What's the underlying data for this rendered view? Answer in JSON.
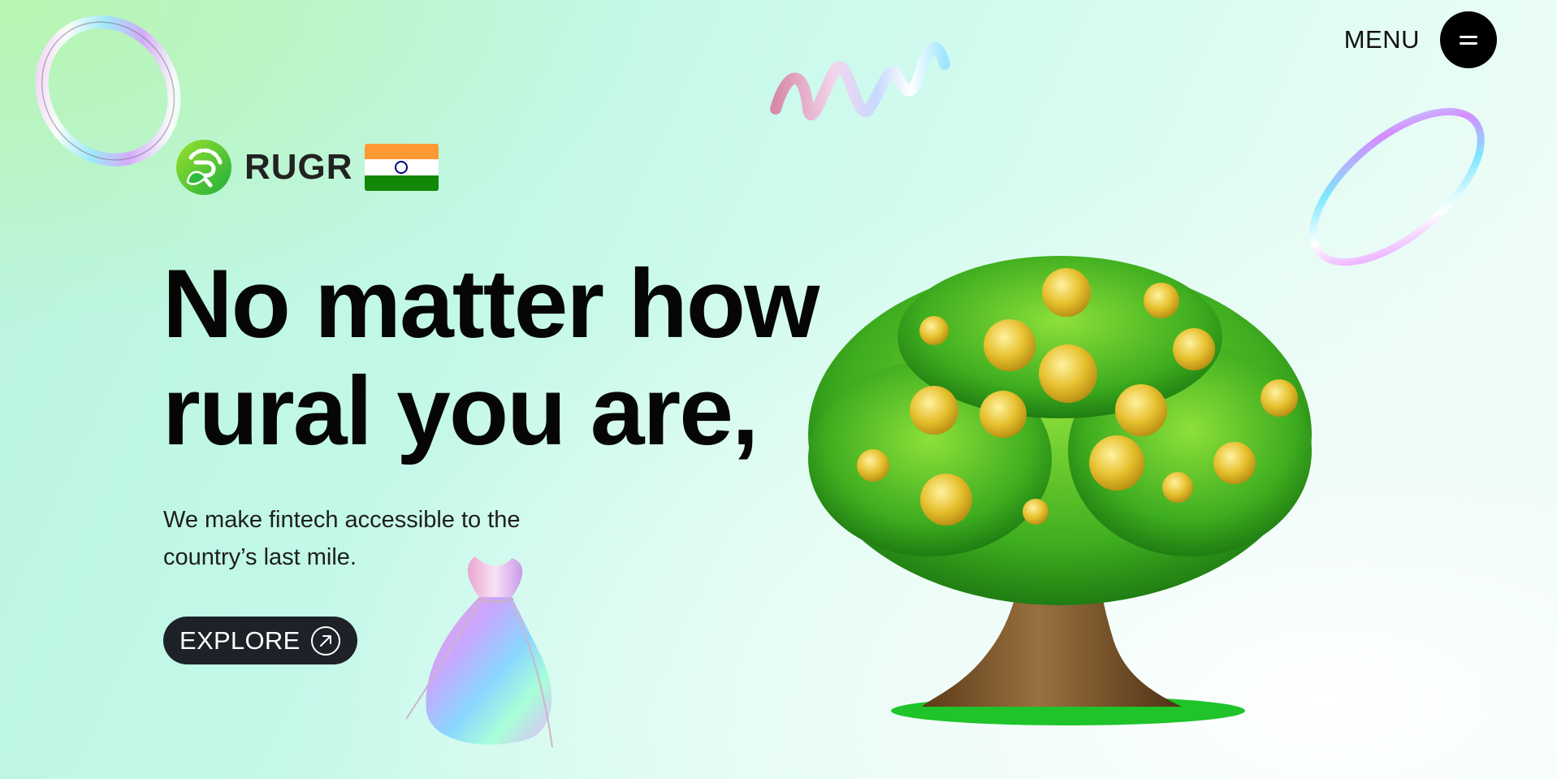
{
  "brand": {
    "name": "RUGR",
    "logo_icon": "rugr-leaf-logo-icon",
    "flag_icon": "india-flag-icon"
  },
  "nav": {
    "menu_label": "MENU",
    "menu_icon": "hamburger-icon"
  },
  "hero": {
    "headline_line1": "No matter how",
    "headline_line2": "rural you are,",
    "subtext": "We make fintech accessible to the country’s last mile.",
    "cta_label": "EXPLORE",
    "cta_icon": "arrow-up-right-icon"
  },
  "decor": {
    "ring_left": "holographic-ring-icon",
    "ring_right": "holographic-ring-icon",
    "spiral": "holographic-spiral-icon",
    "pouch": "holographic-money-bag-icon",
    "tree": "money-tree-icon"
  },
  "colors": {
    "background_start": "#b9f3dd",
    "background_end": "#f6fdfb",
    "button_dark": "#1e2128",
    "menu_button": "#000000",
    "text_dark": "#060606"
  }
}
